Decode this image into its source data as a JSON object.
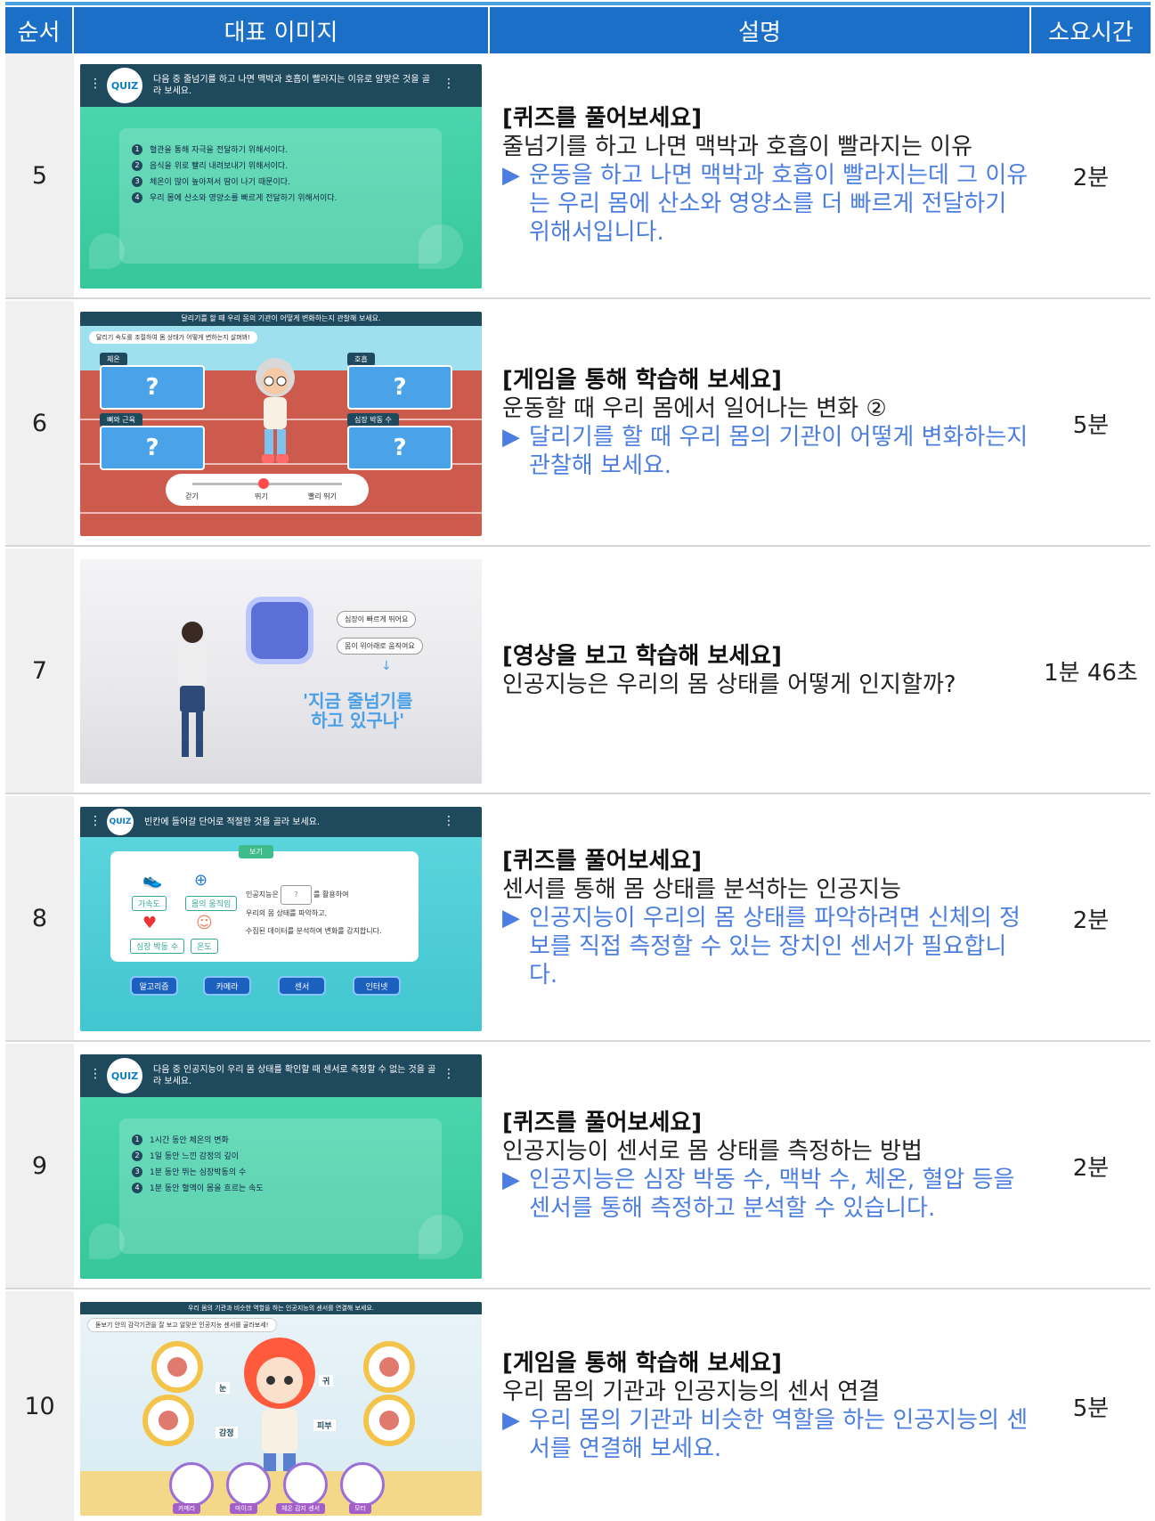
{
  "header": {
    "col_order": "순서",
    "col_image": "대표 이미지",
    "col_desc": "설명",
    "col_time": "소요시간"
  },
  "rows": [
    {
      "order": "5",
      "title": "[퀴즈를 풀어보세요]",
      "sub": "줄넘기를 하고 나면 맥박과 호흡이 빨라지는 이유",
      "detail": "운동을 하고 나면 맥박과 호흡이 빨라지는데 그 이유는 우리 몸에 산소와 영양소를 더 빠르게 전달하기 위해서입니다.",
      "time": "2분",
      "thumb": {
        "logo": "QUIZ",
        "question": "다음 중 줄넘기를 하고 나면 맥박과 호흡이 빨라지는 이유로 알맞은 것을 골라 보세요.",
        "options": [
          "혈관을 통해 자극을 전달하기 위해서이다.",
          "음식을 위로 빨리 내려보내기 위해서이다.",
          "체온이 많이 높아져서 땀이 나기 때문이다.",
          "우리 몸에 산소와 영양소를 빠르게 전달하기 위해서이다."
        ]
      }
    },
    {
      "order": "6",
      "title": "[게임을 통해 학습해 보세요]",
      "sub": "운동할 때 우리 몸에서 일어나는 변화 ②",
      "detail": "달리기를 할 때 우리 몸의 기관이 어떻게 변화하는지 관찰해 보세요.",
      "time": "5분",
      "thumb": {
        "bar": "달리기를 할 때 우리 몸의 기관이 어떻게 변화하는지 관찰해 보세요.",
        "tip": "달리기 속도를 조절하여 몸 상태가 어떻게 변하는지 살펴봐!",
        "labels": [
          "체온",
          "호흡",
          "뼈와 근육",
          "심장 박동 수"
        ],
        "q": "?",
        "speeds": [
          "걷기",
          "뛰기",
          "빨리 뛰기"
        ]
      }
    },
    {
      "order": "7",
      "title": "[영상을 보고 학습해 보세요]",
      "sub": "인공지능은 우리의 몸 상태를 어떻게 인지할까?",
      "detail": "",
      "time": "1분 46초",
      "thumb": {
        "bubble1": "심장이 빠르게 뛰어요",
        "bubble2": "몸이 위아래로 움직여요",
        "caption1": "'지금 줄넘기를",
        "caption2": "하고 있구나'"
      }
    },
    {
      "order": "8",
      "title": "[퀴즈를 풀어보세요]",
      "sub": "센서를 통해 몸 상태를 분석하는 인공지능",
      "detail": "인공지능이 우리의 몸 상태를 파악하려면 신체의 정보를 직접 측정할 수 있는 장치인 센서가 필요합니다.",
      "time": "2분",
      "thumb": {
        "logo": "QUIZ",
        "question": "빈칸에 들어갈 단어로 적절한 것을 골라 보세요.",
        "tag": "보기",
        "icons": [
          "가속도",
          "몸의 움직임",
          "심장 박동 수",
          "온도"
        ],
        "line1a": "인공지능은",
        "line1b": "를 활용하여",
        "line2": "우리의 몸 상태를 파악하고,",
        "line3": "수집된 데이터를 분석하여 변화를 감지합니다.",
        "blank": "?",
        "buttons": [
          "알고리즘",
          "카메라",
          "센서",
          "인터넷"
        ]
      }
    },
    {
      "order": "9",
      "title": "[퀴즈를 풀어보세요]",
      "sub": "인공지능이 센서로 몸 상태를 측정하는 방법",
      "detail": "인공지능은 심장 박동 수, 맥박 수, 체온, 혈압 등을 센서를 통해 측정하고 분석할 수 있습니다.",
      "time": "2분",
      "thumb": {
        "logo": "QUIZ",
        "question": "다음 중 인공지능이 우리 몸 상태를 확인할 때 센서로 측정할 수 없는 것을 골라 보세요.",
        "options": [
          "1시간 동안 체온의 변화",
          "1일 동안 느낀 감정의 깊이",
          "1분 동안 뛰는 심장박동의 수",
          "1분 동안 혈액이 몸을 흐르는 속도"
        ]
      }
    },
    {
      "order": "10",
      "title": "[게임을 통해 학습해 보세요]",
      "sub": "우리 몸의 기관과 인공지능의 센서 연결",
      "detail": "우리 몸의 기관과 비슷한 역할을 하는 인공지능의 센서를 연결해 보세요.",
      "time": "5분",
      "thumb": {
        "bar": "우리 몸의 기관과 비슷한 역할을 하는 인공지능의 센서를 연결해 보세요.",
        "tip": "돋보기 안의 감각기관을 잘 보고 알맞은 인공지능 센서를 골라보세!",
        "parts": [
          "눈",
          "귀",
          "감정",
          "피부"
        ],
        "devices": [
          "카메라",
          "마이크",
          "체온 감지 센서",
          "모터"
        ]
      }
    }
  ],
  "tri": "▶"
}
